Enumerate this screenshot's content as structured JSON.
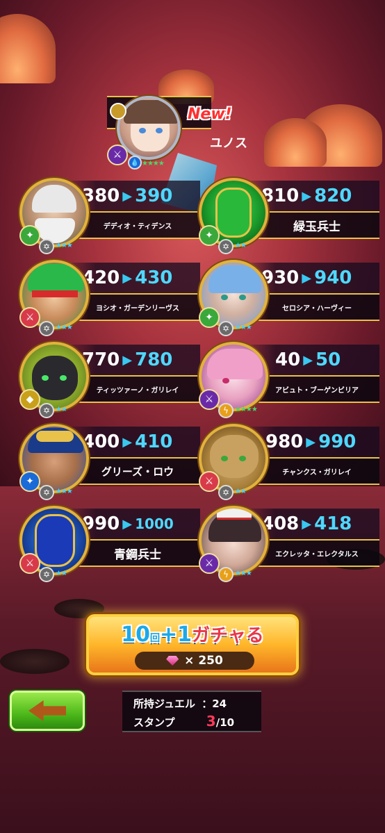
{
  "new_hero": {
    "new_label": "New!",
    "name": "ユノス"
  },
  "cards": [
    {
      "old": "380",
      "new": "390",
      "name": "デディオ・ティデンス"
    },
    {
      "old": "810",
      "new": "820",
      "name": "緑玉兵士"
    },
    {
      "old": "420",
      "new": "430",
      "name": "ヨシオ・ガーデンリーヴス"
    },
    {
      "old": "930",
      "new": "940",
      "name": "セロシア・ハーヴィー"
    },
    {
      "old": "770",
      "new": "780",
      "name": "ティッツァーノ・ガリレイ"
    },
    {
      "old": "40",
      "new": "50",
      "name": "アビュト・ブーゲンビリア"
    },
    {
      "old": "400",
      "new": "410",
      "name": "グリーズ・ロウ"
    },
    {
      "old": "980",
      "new": "990",
      "name": "チャンクス・ガリレイ"
    },
    {
      "old": "990",
      "new": "1000",
      "name": "青鋼兵士"
    },
    {
      "old": "408",
      "new": "418",
      "name": "エクレッタ・エレクタルス"
    }
  ],
  "gacha": {
    "title_num": "10",
    "title_small": "回",
    "title_plus": "+1",
    "title_kana": "ガチャる",
    "cost": "× 250"
  },
  "info": {
    "jewel_label": "所持ジュエル",
    "jewel_value": "：24",
    "stamp_label": "スタンプ",
    "stamp_current": "3",
    "stamp_total": "/10"
  },
  "icons": {
    "back": "left-arrow-icon"
  }
}
